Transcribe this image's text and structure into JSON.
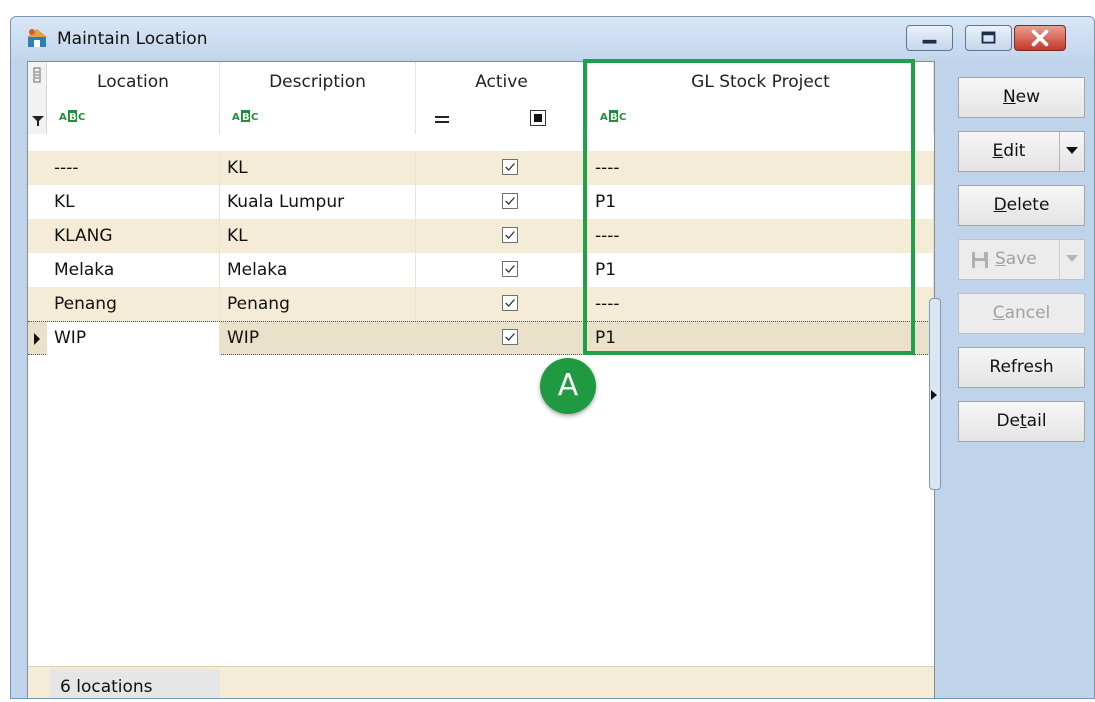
{
  "window": {
    "title": "Maintain Location"
  },
  "columns": [
    {
      "label": "Location"
    },
    {
      "label": "Description"
    },
    {
      "label": "Active"
    },
    {
      "label": "GL Stock Project"
    }
  ],
  "rows": [
    {
      "location": "----",
      "description": "KL",
      "active": true,
      "gl_stock_project": "----"
    },
    {
      "location": "KL",
      "description": "Kuala Lumpur",
      "active": true,
      "gl_stock_project": "P1"
    },
    {
      "location": "KLANG",
      "description": "KL",
      "active": true,
      "gl_stock_project": "----"
    },
    {
      "location": "Melaka",
      "description": "Melaka",
      "active": true,
      "gl_stock_project": "P1"
    },
    {
      "location": "Penang",
      "description": "Penang",
      "active": true,
      "gl_stock_project": "----"
    },
    {
      "location": "WIP",
      "description": "WIP",
      "active": true,
      "gl_stock_project": "P1",
      "current": true
    }
  ],
  "footer": {
    "count": "6 locations"
  },
  "annotation": {
    "badge": "A"
  },
  "buttons": {
    "new": {
      "pre": "",
      "u": "N",
      "post": "ew"
    },
    "edit": {
      "pre": "",
      "u": "E",
      "post": "dit"
    },
    "delete": {
      "pre": "",
      "u": "D",
      "post": "elete"
    },
    "save": {
      "pre": "",
      "u": "S",
      "post": "ave"
    },
    "cancel": {
      "pre": "",
      "u": "C",
      "post": "ancel"
    },
    "refresh": {
      "label": "Refresh"
    },
    "detail": {
      "pre": "De",
      "u": "t",
      "post": "ail"
    }
  },
  "colors": {
    "highlight": "#21a04a",
    "row_alt": "#f4ecd7",
    "row_plain": "#ffffff",
    "selected_row": "#e9e1c9"
  }
}
